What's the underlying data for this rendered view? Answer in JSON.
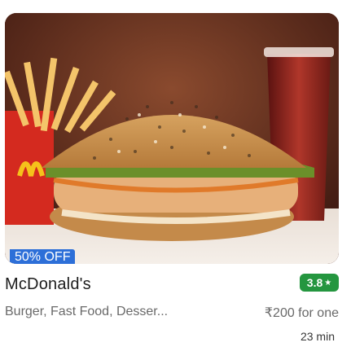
{
  "restaurant": {
    "name": "McDonald's",
    "rating": "3.8",
    "rating_icon": "star-icon",
    "cuisine": "Burger, Fast Food, Desser...",
    "price": "₹200 for one",
    "delivery_time": "23 min",
    "offer": "50% OFF"
  },
  "colors": {
    "offer_bg": "#2d6fd8",
    "rating_bg": "#24963f",
    "text_primary": "#1c1c1c",
    "text_secondary": "#696969"
  }
}
